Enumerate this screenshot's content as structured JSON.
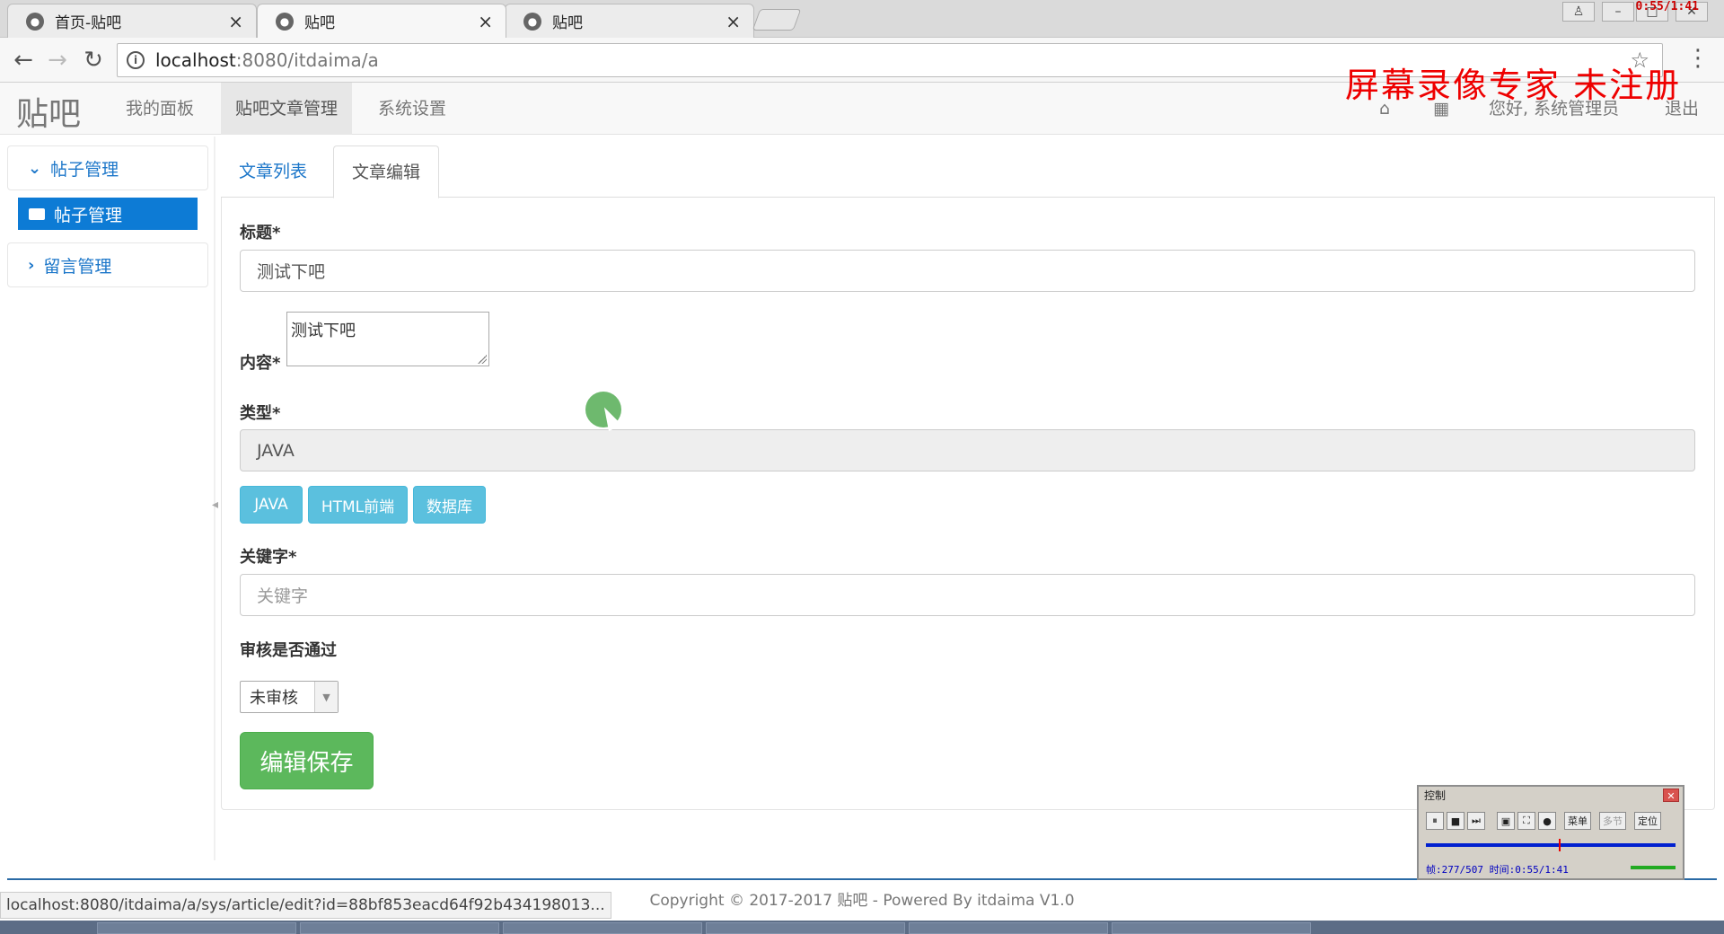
{
  "browser": {
    "tabs": [
      {
        "title": "首页-贴吧",
        "close": "×"
      },
      {
        "title": "贴吧",
        "close": "×"
      },
      {
        "title": "贴吧",
        "close": "×"
      }
    ],
    "recording_time": "0:55/1:41",
    "address": {
      "info_glyph": "i",
      "host": "localhost",
      "path": ":8080/itdaima/a"
    },
    "status_url": "localhost:8080/itdaima/a/sys/article/edit?id=88bf853eacd64f92b434198013..."
  },
  "watermark": "屏幕录像专家  未注册",
  "navbar": {
    "brand": "贴吧",
    "items": [
      {
        "label": "我的面板"
      },
      {
        "label": "贴吧文章管理"
      },
      {
        "label": "系统设置"
      }
    ],
    "greeting": "您好, 系统管理员",
    "logout": "退出"
  },
  "sidebar": {
    "groups": [
      {
        "label": "帖子管理",
        "expanded": true
      },
      {
        "label": "留言管理",
        "expanded": false
      }
    ],
    "active_item": "帖子管理"
  },
  "content_tabs": [
    {
      "label": "文章列表"
    },
    {
      "label": "文章编辑"
    }
  ],
  "form": {
    "title_label": "标题*",
    "title_value": "测试下吧",
    "content_label": "内容*",
    "content_value": "测试下吧",
    "type_label": "类型*",
    "type_value": "JAVA",
    "type_buttons": [
      "JAVA",
      "HTML前端",
      "数据库"
    ],
    "keyword_label": "关键字*",
    "keyword_placeholder": "关键字",
    "review_label": "审核是否通过",
    "review_value": "未审核",
    "save_label": "编辑保存"
  },
  "footer": {
    "copyright": "Copyright © 2017-2017 贴吧 - Powered By itdaima V1.0"
  },
  "recorder": {
    "title": "控制",
    "buttons": [
      "菜单",
      "多节",
      "定位"
    ],
    "info": "帧:277/507 时间:0:55/1:41"
  },
  "colors": {
    "link_blue": "#1b76c9",
    "sidebar_active": "#0d7bd5",
    "info_button": "#5bc0de",
    "success_button": "#5cb85c",
    "watermark_red": "#ee0000"
  }
}
